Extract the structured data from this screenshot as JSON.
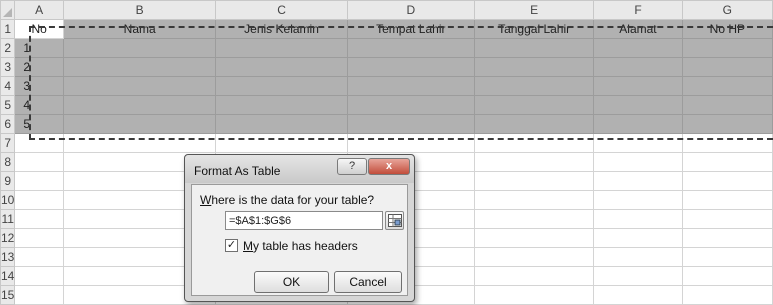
{
  "sheet": {
    "column_headers": [
      "A",
      "B",
      "C",
      "D",
      "E",
      "F",
      "G"
    ],
    "row_headers": [
      "1",
      "2",
      "3",
      "4",
      "5",
      "6",
      "7",
      "8",
      "9",
      "10",
      "11",
      "12",
      "13",
      "14",
      "15"
    ],
    "table_headers": [
      "No",
      "Nama",
      "Jenis Kelamin",
      "Tempat Lahir",
      "Tanggal Lahir",
      "Alamat",
      "No HP"
    ],
    "numbers": [
      "1",
      "2",
      "3",
      "4",
      "5"
    ],
    "selection_color": "#b1b1b1"
  },
  "dialog": {
    "title": "Format As Table",
    "help_label": "?",
    "close_label": "x",
    "prompt_underlined": "W",
    "prompt_rest": "here is the data for your table?",
    "range_value": "=$A$1:$G$6",
    "headers_checked": "✓",
    "headers_label_underlined": "M",
    "headers_label_rest": "y table has headers",
    "ok_label": "OK",
    "cancel_label": "Cancel",
    "close_color": "#c24d3b"
  }
}
